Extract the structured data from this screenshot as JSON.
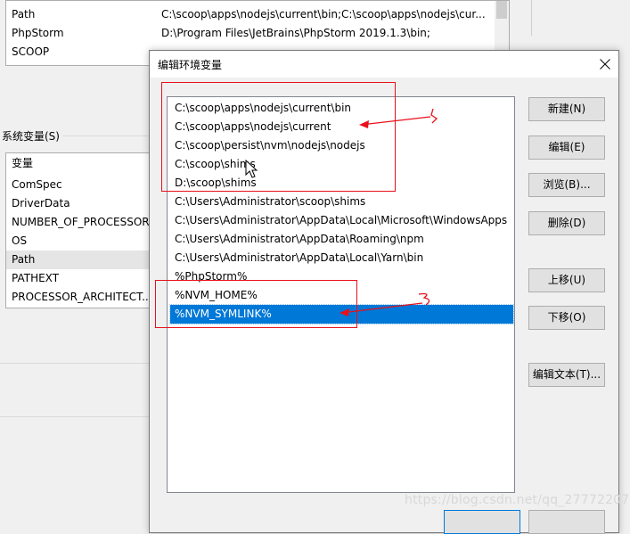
{
  "background": {
    "user_vars": [
      {
        "name": "Path",
        "value": "C:\\scoop\\apps\\nodejs\\current\\bin;C:\\scoop\\apps\\nodejs\\cur..."
      },
      {
        "name": "PhpStorm",
        "value": "D:\\Program Files\\JetBrains\\PhpStorm 2019.1.3\\bin;"
      },
      {
        "name": "SCOOP",
        "value": ""
      }
    ],
    "system_section_label": "系统变量(S)",
    "system_vars": [
      "变量",
      "ComSpec",
      "DriverData",
      "NUMBER_OF_PROCESSORS",
      "OS",
      "Path",
      "PATHEXT",
      "PROCESSOR_ARCHITECT..."
    ]
  },
  "dialog": {
    "title": "编辑环境变量",
    "entries": [
      "C:\\scoop\\apps\\nodejs\\current\\bin",
      "C:\\scoop\\apps\\nodejs\\current",
      "C:\\scoop\\persist\\nvm\\nodejs\\nodejs",
      "C:\\scoop\\shims",
      "D:\\scoop\\shims",
      "C:\\Users\\Administrator\\scoop\\shims",
      "C:\\Users\\Administrator\\AppData\\Local\\Microsoft\\WindowsApps",
      "C:\\Users\\Administrator\\AppData\\Roaming\\npm",
      "C:\\Users\\Administrator\\AppData\\Local\\Yarn\\bin",
      "%PhpStorm%",
      "%NVM_HOME%",
      "%NVM_SYMLINK%"
    ],
    "selected_index": 11,
    "buttons": {
      "new": "新建(N)",
      "edit": "编辑(E)",
      "browse": "浏览(B)...",
      "delete": "删除(D)",
      "move_up": "上移(U)",
      "move_down": "下移(O)",
      "edit_text": "编辑文本(T)..."
    }
  },
  "watermark": "https://blog.csdn.net/qq_27772207",
  "colors": {
    "selection": "#0078d7",
    "annotation": "#e8101a"
  }
}
